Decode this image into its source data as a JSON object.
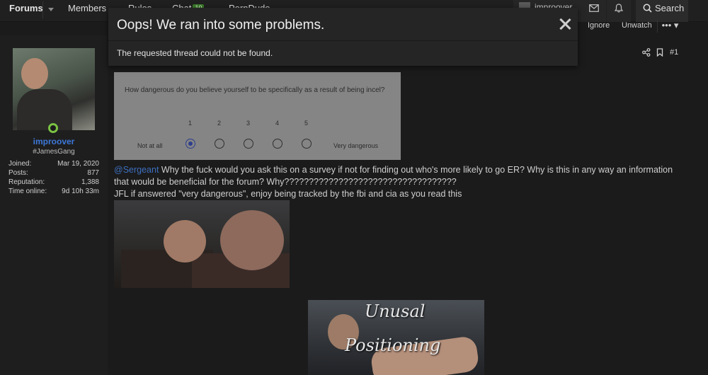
{
  "nav": {
    "forums": "Forums",
    "members": "Members",
    "rules": "Rules",
    "chat": "Chat",
    "chat_badge": "10",
    "porndude": "PornDude",
    "username": "improover",
    "search": "Search"
  },
  "thread_tools": {
    "ignore": "Ignore",
    "unwatch": "Unwatch",
    "more": "•••"
  },
  "user": {
    "name": "improover",
    "title": "#JamesGang",
    "stats": [
      {
        "label": "Joined:",
        "value": "Mar 19, 2020"
      },
      {
        "label": "Posts:",
        "value": "877"
      },
      {
        "label": "Reputation:",
        "value": "1,388"
      },
      {
        "label": "Time online:",
        "value": "9d 10h 33m"
      }
    ]
  },
  "post": {
    "number": "#1",
    "survey": {
      "question": "How dangerous do you believe yourself to be specifically as a result of being incel?",
      "scale": [
        "1",
        "2",
        "3",
        "4",
        "5"
      ],
      "low_label": "Not at all",
      "high_label": "Very dangerous",
      "selected": "1"
    },
    "mention": "@Sergeant",
    "text_1": " Why the fuck would you ask this on a survey if not for finding out who's more likely to go ER? Why is this in any way an information that would be beneficial for the forum? Why???????????????????????????????????",
    "text_2": "JFL if answered \"very dangerous\", enjoy being tracked by the fbi and cia as you read this",
    "gif_caption_1": "Unusal",
    "gif_caption_2": "Positioning"
  },
  "dialog": {
    "title": "Oops! We ran into some problems.",
    "message": "The requested thread could not be found."
  },
  "colors": {
    "accent_link": "#3d78d8",
    "online": "#7ac143",
    "chat_badge": "#3a7a2a"
  }
}
